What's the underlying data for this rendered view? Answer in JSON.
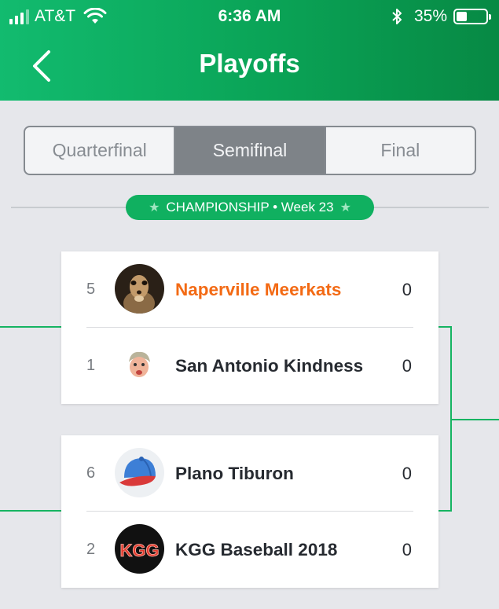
{
  "status_bar": {
    "carrier": "AT&T",
    "time": "6:36 AM",
    "battery": "35%",
    "battery_level": 0.35
  },
  "header": {
    "title": "Playoffs",
    "back_icon": "chevron-left-icon"
  },
  "tabs": [
    {
      "label": "Quarterfinal",
      "active": false
    },
    {
      "label": "Semifinal",
      "active": true
    },
    {
      "label": "Final",
      "active": false
    }
  ],
  "round_banner": {
    "label": "CHAMPIONSHIP • Week 23",
    "icon": "star-icon"
  },
  "colors": {
    "header_green": "#0aa356",
    "accent_green": "#10b060",
    "highlight_orange": "#f36a14",
    "active_tab_gray": "#7e8388"
  },
  "matchups": [
    {
      "teams": [
        {
          "seed": "5",
          "name": "Naperville Meerkats",
          "score": "0",
          "avatar": "meerkat-avatar",
          "highlight": true
        },
        {
          "seed": "1",
          "name": "San Antonio Kindness",
          "score": "0",
          "avatar": "cartoon-face-avatar",
          "highlight": false
        }
      ]
    },
    {
      "teams": [
        {
          "seed": "6",
          "name": "Plano Tiburon",
          "score": "0",
          "avatar": "baseball-cap-avatar",
          "highlight": false
        },
        {
          "seed": "2",
          "name": "KGG Baseball 2018",
          "score": "0",
          "avatar": "kgg-logo-avatar",
          "logo_text": "KGG",
          "highlight": false
        }
      ]
    }
  ]
}
